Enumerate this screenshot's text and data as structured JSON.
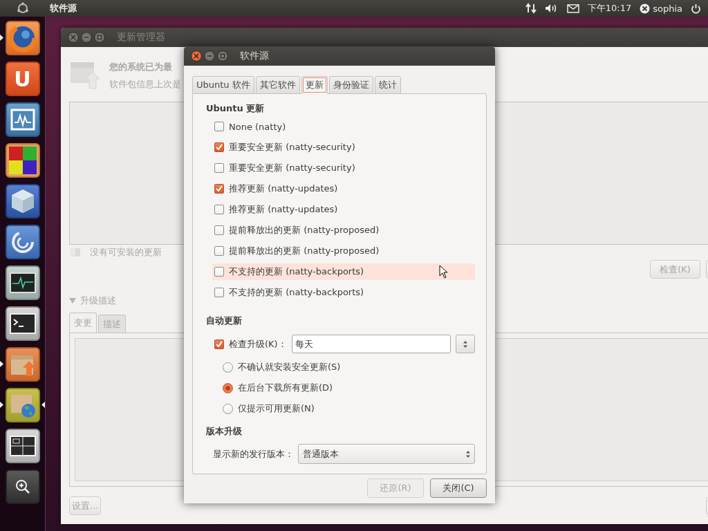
{
  "top_panel": {
    "app_title": "软件源",
    "clock": "下午10:17",
    "user": "sophia"
  },
  "launcher": {
    "items": [
      {
        "kind": "browser",
        "running": true,
        "focused": false
      },
      {
        "kind": "letter",
        "glyph": "U",
        "running": false,
        "focused": false
      },
      {
        "kind": "monitor",
        "running": false,
        "focused": false
      },
      {
        "kind": "cubes",
        "running": false,
        "focused": false
      },
      {
        "kind": "cube",
        "running": false,
        "focused": false
      },
      {
        "kind": "swirl",
        "running": false,
        "focused": false
      },
      {
        "kind": "pulse",
        "running": false,
        "focused": false
      },
      {
        "kind": "terminal",
        "running": false,
        "focused": false
      },
      {
        "kind": "package-up",
        "running": true,
        "focused": false
      },
      {
        "kind": "package-globe",
        "running": true,
        "focused": true
      },
      {
        "kind": "workspaces",
        "running": false,
        "focused": false
      },
      {
        "kind": "zoom",
        "running": false,
        "focused": false
      }
    ]
  },
  "update_manager": {
    "title": "更新管理器",
    "status_title": "您的系统已为最",
    "status_detail": "软件包信息上次是",
    "no_updates_label": "没有可安装的更新",
    "check_button": "检查(K)",
    "details_expander": {
      "label": "升级描述",
      "expanded": true
    },
    "tabs": [
      {
        "label": "变更",
        "selected": true
      },
      {
        "label": "描述",
        "selected": false
      }
    ],
    "settings_button": "设置..."
  },
  "dialog": {
    "title": "软件源",
    "tabs": [
      {
        "label": "Ubuntu 软件",
        "selected": false
      },
      {
        "label": "其它软件",
        "selected": false
      },
      {
        "label": "更新",
        "selected": true
      },
      {
        "label": "身份验证",
        "selected": false
      },
      {
        "label": "统计",
        "selected": false
      }
    ],
    "ubuntu_updates": {
      "title": "Ubuntu 更新",
      "options": [
        {
          "label": "None (natty)",
          "checked": false,
          "hovered": false
        },
        {
          "label": "重要安全更新 (natty-security)",
          "checked": true,
          "hovered": false
        },
        {
          "label": "重要安全更新 (natty-security)",
          "checked": false,
          "hovered": false
        },
        {
          "label": "推荐更新 (natty-updates)",
          "checked": true,
          "hovered": false
        },
        {
          "label": "推荐更新 (natty-updates)",
          "checked": false,
          "hovered": false
        },
        {
          "label": "提前释放出的更新 (natty-proposed)",
          "checked": false,
          "hovered": false
        },
        {
          "label": "提前释放出的更新 (natty-proposed)",
          "checked": false,
          "hovered": false
        },
        {
          "label": "不支持的更新 (natty-backports)",
          "checked": false,
          "hovered": true
        },
        {
          "label": "不支持的更新 (natty-backports)",
          "checked": false,
          "hovered": false
        }
      ]
    },
    "auto_update": {
      "title": "自动更新",
      "check": {
        "label": "检查升级(K)：",
        "checked": true
      },
      "interval": "每天",
      "radios": [
        {
          "label": "不确认就安装安全更新(S)",
          "selected": false
        },
        {
          "label": "在后台下载所有更新(D)",
          "selected": true
        },
        {
          "label": "仅提示可用更新(N)",
          "selected": false
        }
      ]
    },
    "release_upgrade": {
      "title": "版本升级",
      "label": "显示新的发行版本：",
      "value": "普通版本"
    },
    "buttons": [
      {
        "label": "还原(R)",
        "disabled": true
      },
      {
        "label": "关闭(C)",
        "disabled": false
      }
    ]
  }
}
